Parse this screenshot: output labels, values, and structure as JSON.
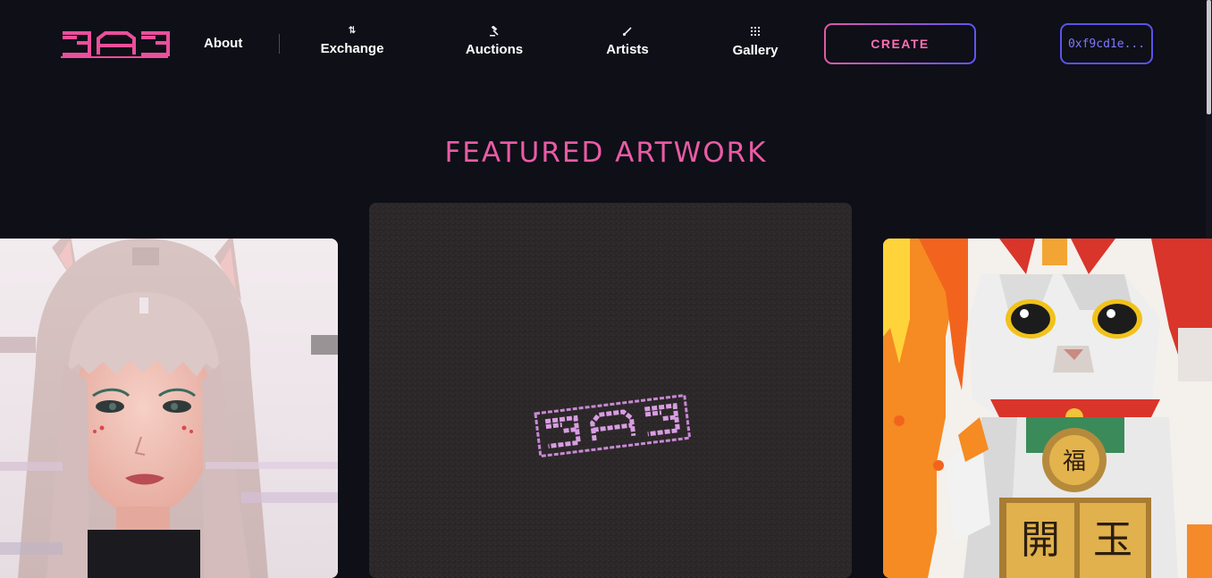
{
  "header": {
    "logo_alt": "BAB",
    "nav": {
      "about": "About",
      "exchange": "Exchange",
      "auctions": "Auctions",
      "artists": "Artists",
      "gallery": "Gallery"
    },
    "create_button": "CREATE",
    "wallet_address": "0xf9cd1e..."
  },
  "featured": {
    "title": "FEATURED ARTWORK",
    "cards": [
      {
        "position": "left",
        "subject": "glitch-portrait-girl-with-fox-ears"
      },
      {
        "position": "center",
        "subject": "bab-logo-on-dark-texture"
      },
      {
        "position": "right",
        "subject": "pixel-lucky-cat-maneki-neko"
      }
    ]
  },
  "icons": {
    "exchange": "exchange-arrows-icon",
    "auctions": "gavel-icon",
    "artists": "brush-icon",
    "gallery": "grid-icon"
  },
  "colors": {
    "background": "#0e0f17",
    "accent_pink": "#ea5ba6",
    "accent_purple": "#5a54e8"
  }
}
